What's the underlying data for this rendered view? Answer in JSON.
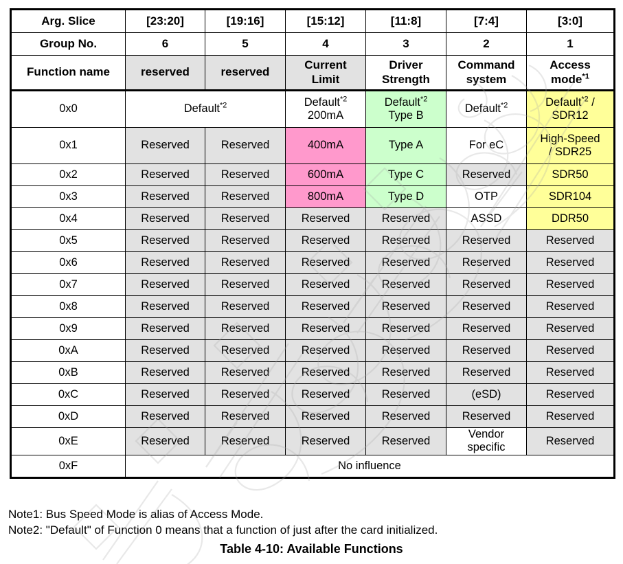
{
  "table": {
    "col_widths_note": "7 columns",
    "header_rows": [
      {
        "label": "Arg. Slice",
        "cells": [
          "[23:20]",
          "[19:16]",
          "[15:12]",
          "[11:8]",
          "[7:4]",
          "[3:0]"
        ]
      },
      {
        "label": "Group No.",
        "cells": [
          "6",
          "5",
          "4",
          "3",
          "2",
          "1"
        ]
      }
    ],
    "function_name_row": {
      "label": "Function name",
      "cells": [
        {
          "line1": "reserved",
          "line2": "",
          "sup": ""
        },
        {
          "line1": "reserved",
          "line2": "",
          "sup": ""
        },
        {
          "line1": "Current",
          "line2": "Limit",
          "sup": ""
        },
        {
          "line1": "Driver",
          "line2": "Strength",
          "sup": ""
        },
        {
          "line1": "Command",
          "line2": "system",
          "sup": ""
        },
        {
          "line1": "Access",
          "line2": "mode",
          "sup": "*1"
        }
      ]
    },
    "rows": [
      {
        "id": "0x0",
        "merged_first_two": true,
        "cells": [
          {
            "line1": "Default",
            "sup1": "*2",
            "line2": "",
            "bg": "white"
          },
          {
            "line1": "Default",
            "sup1": "*2",
            "line2": "200mA",
            "bg": "white"
          },
          {
            "line1": "Default",
            "sup1": "*2",
            "line2": "Type B",
            "bg": "green"
          },
          {
            "line1": "Default",
            "sup1": "*2",
            "line2": "",
            "bg": "white"
          },
          {
            "line1": "Default",
            "sup1": "*2",
            "line2": "/ SDR12",
            "bg": "yellow",
            "slash_after_sup": true
          }
        ]
      },
      {
        "id": "0x1",
        "merged_first_two": false,
        "cells": [
          {
            "line1": "Reserved",
            "sup1": "",
            "line2": "",
            "bg": "gray"
          },
          {
            "line1": "Reserved",
            "sup1": "",
            "line2": "",
            "bg": "gray"
          },
          {
            "line1": "400mA",
            "sup1": "",
            "line2": "",
            "bg": "pink"
          },
          {
            "line1": "Type A",
            "sup1": "",
            "line2": "",
            "bg": "green"
          },
          {
            "line1": "For eC",
            "sup1": "",
            "line2": "",
            "bg": "white"
          },
          {
            "line1": "High-Speed",
            "sup1": "",
            "line2": "/ SDR25",
            "bg": "yellow"
          }
        ]
      },
      {
        "id": "0x2",
        "merged_first_two": false,
        "cells": [
          {
            "line1": "Reserved",
            "sup1": "",
            "line2": "",
            "bg": "gray"
          },
          {
            "line1": "Reserved",
            "sup1": "",
            "line2": "",
            "bg": "gray"
          },
          {
            "line1": "600mA",
            "sup1": "",
            "line2": "",
            "bg": "pink"
          },
          {
            "line1": "Type C",
            "sup1": "",
            "line2": "",
            "bg": "green"
          },
          {
            "line1": "Reserved",
            "sup1": "",
            "line2": "",
            "bg": "gray"
          },
          {
            "line1": "SDR50",
            "sup1": "",
            "line2": "",
            "bg": "yellow"
          }
        ]
      },
      {
        "id": "0x3",
        "merged_first_two": false,
        "cells": [
          {
            "line1": "Reserved",
            "sup1": "",
            "line2": "",
            "bg": "gray"
          },
          {
            "line1": "Reserved",
            "sup1": "",
            "line2": "",
            "bg": "gray"
          },
          {
            "line1": "800mA",
            "sup1": "",
            "line2": "",
            "bg": "pink"
          },
          {
            "line1": "Type D",
            "sup1": "",
            "line2": "",
            "bg": "green"
          },
          {
            "line1": "OTP",
            "sup1": "",
            "line2": "",
            "bg": "white"
          },
          {
            "line1": "SDR104",
            "sup1": "",
            "line2": "",
            "bg": "yellow"
          }
        ]
      },
      {
        "id": "0x4",
        "merged_first_two": false,
        "cells": [
          {
            "line1": "Reserved",
            "sup1": "",
            "line2": "",
            "bg": "gray"
          },
          {
            "line1": "Reserved",
            "sup1": "",
            "line2": "",
            "bg": "gray"
          },
          {
            "line1": "Reserved",
            "sup1": "",
            "line2": "",
            "bg": "gray"
          },
          {
            "line1": "Reserved",
            "sup1": "",
            "line2": "",
            "bg": "gray"
          },
          {
            "line1": "ASSD",
            "sup1": "",
            "line2": "",
            "bg": "white"
          },
          {
            "line1": "DDR50",
            "sup1": "",
            "line2": "",
            "bg": "yellow"
          }
        ]
      },
      {
        "id": "0x5",
        "merged_first_two": false,
        "cells": [
          {
            "line1": "Reserved",
            "sup1": "",
            "line2": "",
            "bg": "gray"
          },
          {
            "line1": "Reserved",
            "sup1": "",
            "line2": "",
            "bg": "gray"
          },
          {
            "line1": "Reserved",
            "sup1": "",
            "line2": "",
            "bg": "gray"
          },
          {
            "line1": "Reserved",
            "sup1": "",
            "line2": "",
            "bg": "gray"
          },
          {
            "line1": "Reserved",
            "sup1": "",
            "line2": "",
            "bg": "gray"
          },
          {
            "line1": "Reserved",
            "sup1": "",
            "line2": "",
            "bg": "gray"
          }
        ]
      },
      {
        "id": "0x6",
        "merged_first_two": false,
        "cells": [
          {
            "line1": "Reserved",
            "sup1": "",
            "line2": "",
            "bg": "gray"
          },
          {
            "line1": "Reserved",
            "sup1": "",
            "line2": "",
            "bg": "gray"
          },
          {
            "line1": "Reserved",
            "sup1": "",
            "line2": "",
            "bg": "gray"
          },
          {
            "line1": "Reserved",
            "sup1": "",
            "line2": "",
            "bg": "gray"
          },
          {
            "line1": "Reserved",
            "sup1": "",
            "line2": "",
            "bg": "gray"
          },
          {
            "line1": "Reserved",
            "sup1": "",
            "line2": "",
            "bg": "gray"
          }
        ]
      },
      {
        "id": "0x7",
        "merged_first_two": false,
        "cells": [
          {
            "line1": "Reserved",
            "sup1": "",
            "line2": "",
            "bg": "gray"
          },
          {
            "line1": "Reserved",
            "sup1": "",
            "line2": "",
            "bg": "gray"
          },
          {
            "line1": "Reserved",
            "sup1": "",
            "line2": "",
            "bg": "gray"
          },
          {
            "line1": "Reserved",
            "sup1": "",
            "line2": "",
            "bg": "gray"
          },
          {
            "line1": "Reserved",
            "sup1": "",
            "line2": "",
            "bg": "gray"
          },
          {
            "line1": "Reserved",
            "sup1": "",
            "line2": "",
            "bg": "gray"
          }
        ]
      },
      {
        "id": "0x8",
        "merged_first_two": false,
        "cells": [
          {
            "line1": "Reserved",
            "sup1": "",
            "line2": "",
            "bg": "gray"
          },
          {
            "line1": "Reserved",
            "sup1": "",
            "line2": "",
            "bg": "gray"
          },
          {
            "line1": "Reserved",
            "sup1": "",
            "line2": "",
            "bg": "gray"
          },
          {
            "line1": "Reserved",
            "sup1": "",
            "line2": "",
            "bg": "gray"
          },
          {
            "line1": "Reserved",
            "sup1": "",
            "line2": "",
            "bg": "gray"
          },
          {
            "line1": "Reserved",
            "sup1": "",
            "line2": "",
            "bg": "gray"
          }
        ]
      },
      {
        "id": "0x9",
        "merged_first_two": false,
        "cells": [
          {
            "line1": "Reserved",
            "sup1": "",
            "line2": "",
            "bg": "gray"
          },
          {
            "line1": "Reserved",
            "sup1": "",
            "line2": "",
            "bg": "gray"
          },
          {
            "line1": "Reserved",
            "sup1": "",
            "line2": "",
            "bg": "gray"
          },
          {
            "line1": "Reserved",
            "sup1": "",
            "line2": "",
            "bg": "gray"
          },
          {
            "line1": "Reserved",
            "sup1": "",
            "line2": "",
            "bg": "gray"
          },
          {
            "line1": "Reserved",
            "sup1": "",
            "line2": "",
            "bg": "gray"
          }
        ]
      },
      {
        "id": "0xA",
        "merged_first_two": false,
        "cells": [
          {
            "line1": "Reserved",
            "sup1": "",
            "line2": "",
            "bg": "gray"
          },
          {
            "line1": "Reserved",
            "sup1": "",
            "line2": "",
            "bg": "gray"
          },
          {
            "line1": "Reserved",
            "sup1": "",
            "line2": "",
            "bg": "gray"
          },
          {
            "line1": "Reserved",
            "sup1": "",
            "line2": "",
            "bg": "gray"
          },
          {
            "line1": "Reserved",
            "sup1": "",
            "line2": "",
            "bg": "gray"
          },
          {
            "line1": "Reserved",
            "sup1": "",
            "line2": "",
            "bg": "gray"
          }
        ]
      },
      {
        "id": "0xB",
        "merged_first_two": false,
        "cells": [
          {
            "line1": "Reserved",
            "sup1": "",
            "line2": "",
            "bg": "gray"
          },
          {
            "line1": "Reserved",
            "sup1": "",
            "line2": "",
            "bg": "gray"
          },
          {
            "line1": "Reserved",
            "sup1": "",
            "line2": "",
            "bg": "gray"
          },
          {
            "line1": "Reserved",
            "sup1": "",
            "line2": "",
            "bg": "gray"
          },
          {
            "line1": "Reserved",
            "sup1": "",
            "line2": "",
            "bg": "gray"
          },
          {
            "line1": "Reserved",
            "sup1": "",
            "line2": "",
            "bg": "gray"
          }
        ]
      },
      {
        "id": "0xC",
        "merged_first_two": false,
        "cells": [
          {
            "line1": "Reserved",
            "sup1": "",
            "line2": "",
            "bg": "gray"
          },
          {
            "line1": "Reserved",
            "sup1": "",
            "line2": "",
            "bg": "gray"
          },
          {
            "line1": "Reserved",
            "sup1": "",
            "line2": "",
            "bg": "gray"
          },
          {
            "line1": "Reserved",
            "sup1": "",
            "line2": "",
            "bg": "gray"
          },
          {
            "line1": "(eSD)",
            "sup1": "",
            "line2": "",
            "bg": "gray"
          },
          {
            "line1": "Reserved",
            "sup1": "",
            "line2": "",
            "bg": "gray"
          }
        ]
      },
      {
        "id": "0xD",
        "merged_first_two": false,
        "cells": [
          {
            "line1": "Reserved",
            "sup1": "",
            "line2": "",
            "bg": "gray"
          },
          {
            "line1": "Reserved",
            "sup1": "",
            "line2": "",
            "bg": "gray"
          },
          {
            "line1": "Reserved",
            "sup1": "",
            "line2": "",
            "bg": "gray"
          },
          {
            "line1": "Reserved",
            "sup1": "",
            "line2": "",
            "bg": "gray"
          },
          {
            "line1": "Reserved",
            "sup1": "",
            "line2": "",
            "bg": "gray"
          },
          {
            "line1": "Reserved",
            "sup1": "",
            "line2": "",
            "bg": "gray"
          }
        ]
      },
      {
        "id": "0xE",
        "merged_first_two": false,
        "cells": [
          {
            "line1": "Reserved",
            "sup1": "",
            "line2": "",
            "bg": "gray"
          },
          {
            "line1": "Reserved",
            "sup1": "",
            "line2": "",
            "bg": "gray"
          },
          {
            "line1": "Reserved",
            "sup1": "",
            "line2": "",
            "bg": "gray"
          },
          {
            "line1": "Reserved",
            "sup1": "",
            "line2": "",
            "bg": "gray"
          },
          {
            "line1": "Vendor",
            "sup1": "",
            "line2": "specific",
            "bg": "white"
          },
          {
            "line1": "Reserved",
            "sup1": "",
            "line2": "",
            "bg": "gray"
          }
        ]
      }
    ],
    "last_row": {
      "id": "0xF",
      "span_text": "No influence",
      "bg": "white"
    }
  },
  "notes": {
    "note1": "Note1: Bus Speed Mode is alias of Access Mode.",
    "note2": "Note2: \"Default\" of Function 0 means that a function of just after the card initialized."
  },
  "caption": "Table 4-10: Available Functions",
  "watermark": {
    "text": "eSoCtail",
    "color": "#b5b5b5"
  },
  "colors": {
    "white": "#ffffff",
    "gray": "#e2e2e2",
    "pink": "#ff99cc",
    "green": "#ccffcc",
    "yellow": "#ffff99",
    "border": "#000000"
  }
}
